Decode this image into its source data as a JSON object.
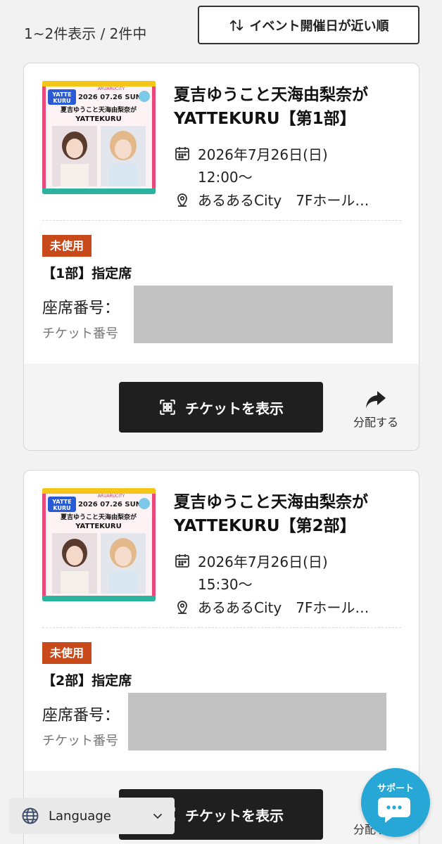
{
  "list": {
    "count_text": "1~2件表示 / 2件中",
    "sort_label": "イベント開催日が近い順"
  },
  "tickets": [
    {
      "thumb": {
        "brand_top": "YATTE",
        "brand_bottom": "KURU",
        "venue_tag": "ARUARUCITY",
        "date": "2026 07.26 SUN",
        "title_line1": "夏吉ゆうこと天海由梨奈が",
        "title_line2": "YATTEKURU"
      },
      "title": "夏吉ゆうこと天海由梨奈がYATTEKURU【第1部】",
      "date": "2026年7月26日(日)",
      "time": "12:00〜",
      "venue": "あるあるCity　7Fホール…",
      "status": "未使用",
      "seat_type": "【1部】指定席",
      "seat_label": "座席番号：",
      "ticket_label": "チケット番号",
      "show_button": "チケットを表示",
      "share_label": "分配する"
    },
    {
      "thumb": {
        "brand_top": "YATTE",
        "brand_bottom": "KURU",
        "venue_tag": "ARUARUCITY",
        "date": "2026 07.26 SUN",
        "title_line1": "夏吉ゆうこと天海由梨奈が",
        "title_line2": "YATTEKURU"
      },
      "title": "夏吉ゆうこと天海由梨奈がYATTEKURU【第2部】",
      "date": "2026年7月26日(日)",
      "time": "15:30〜",
      "venue": "あるあるCity　7Fホール…",
      "status": "未使用",
      "seat_type": "【2部】指定席",
      "seat_label": "座席番号：",
      "ticket_label": "チケット番号",
      "show_button": "チケットを表示",
      "share_label": "分配する"
    }
  ],
  "language": {
    "label": "Language"
  },
  "support": {
    "label": "サポート"
  },
  "colors": {
    "badge": "#c84a1b",
    "button": "#1f1f1f",
    "support": "#26a7d6"
  }
}
